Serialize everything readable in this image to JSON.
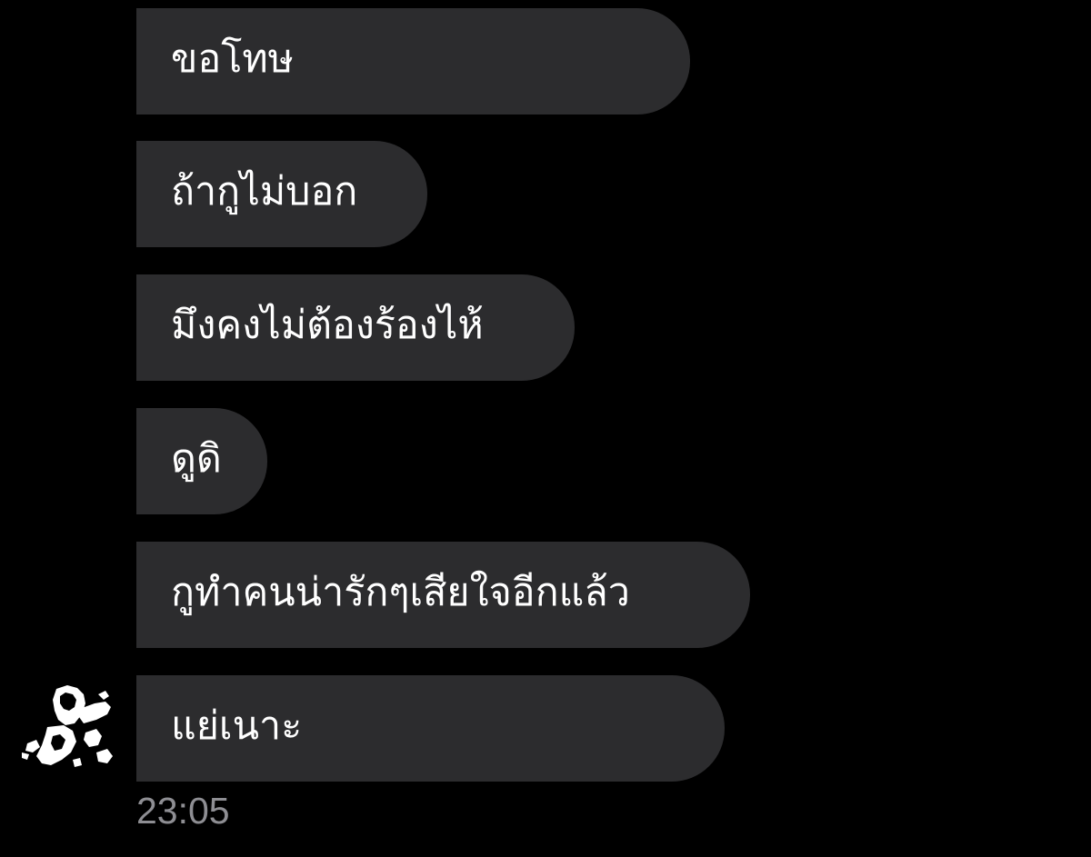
{
  "conversation": {
    "messages": [
      {
        "text": "ขอโทษ"
      },
      {
        "text": "ถ้ากูไม่บอก"
      },
      {
        "text": "มึงคงไม่ต้องร้องไห้"
      },
      {
        "text": "ดูดิ"
      },
      {
        "text": "กูทำคนน่ารักๆเสียใจอีกแล้ว"
      },
      {
        "text": "แย่เนาะ"
      }
    ],
    "timestamp": "23:05",
    "sender_avatar_icon": "avatar-photo",
    "colors": {
      "background": "#000000",
      "bubble": "#2c2c2e",
      "message_text": "#ffffff",
      "timestamp": "#8e8e93"
    }
  }
}
